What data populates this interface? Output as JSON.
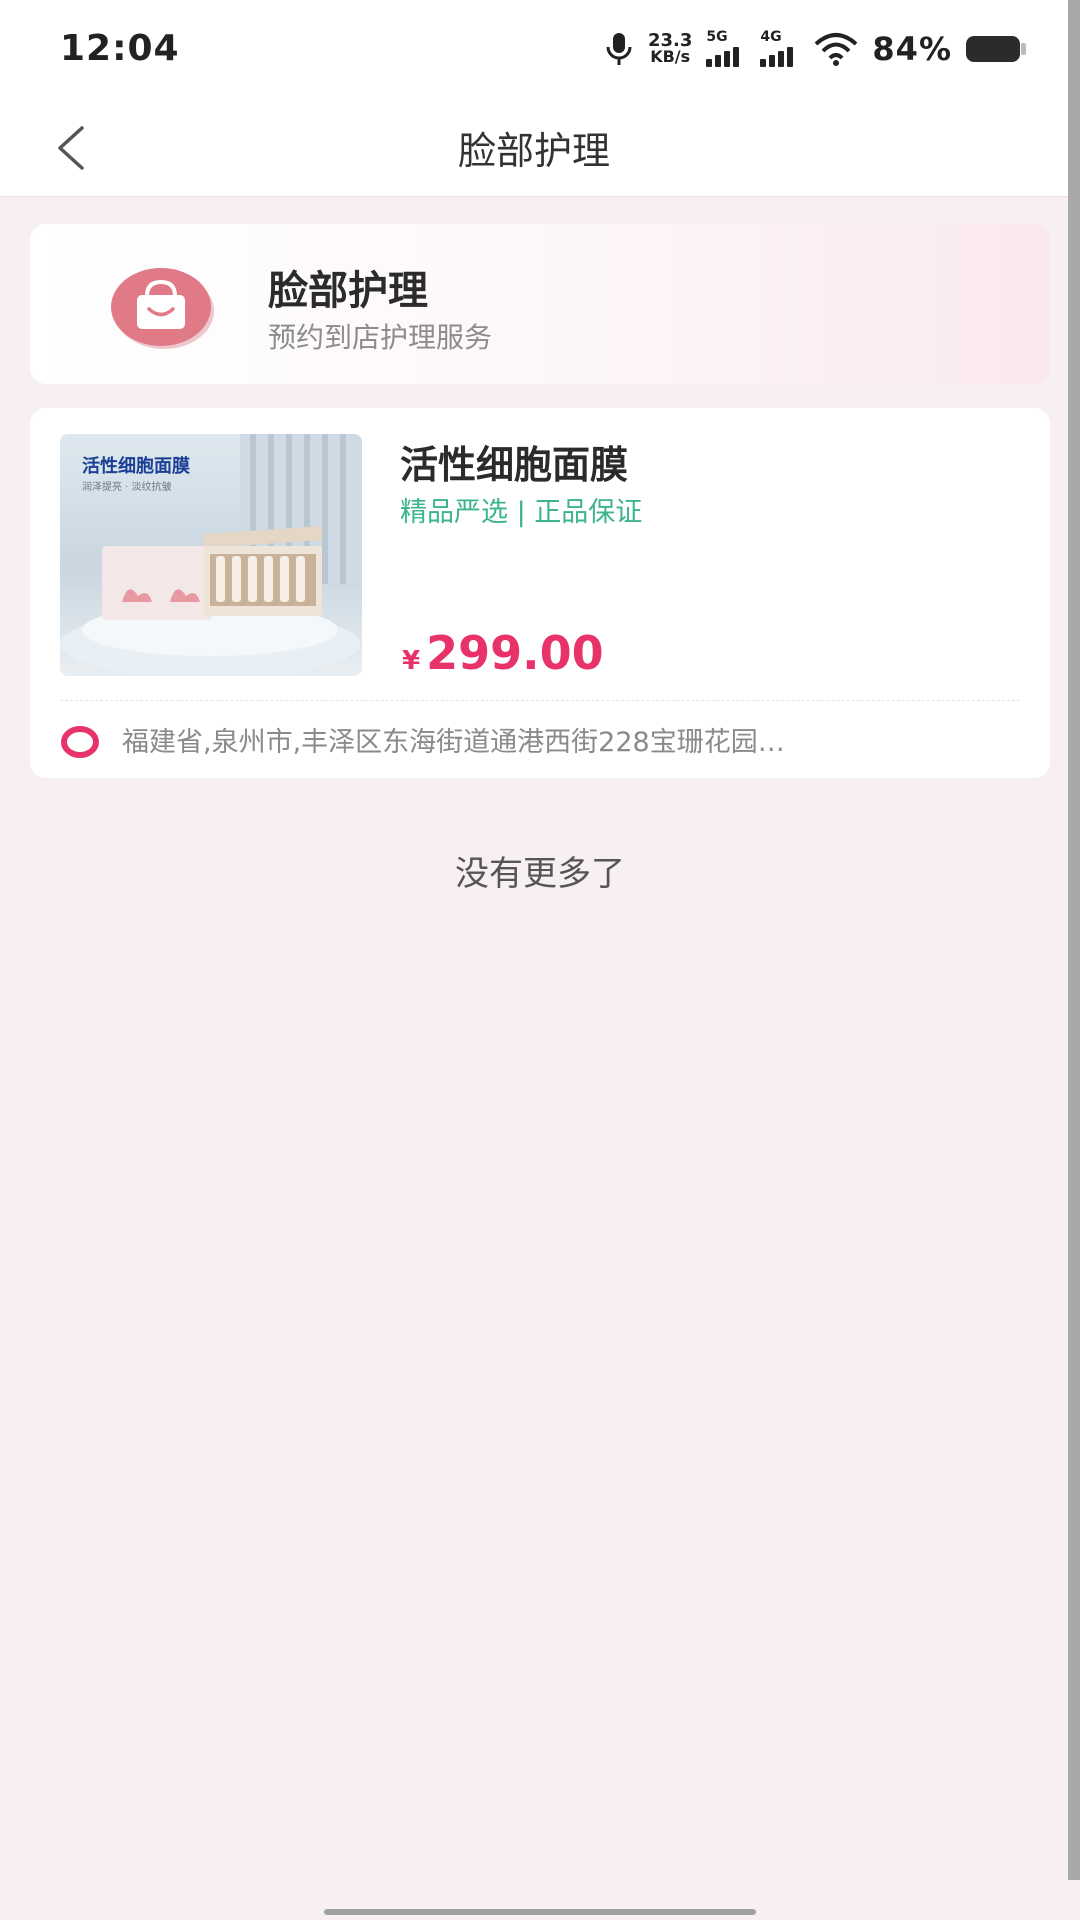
{
  "status": {
    "time": "12:04",
    "speed_value": "23.3",
    "speed_unit": "KB/s",
    "net1": "5G",
    "net2": "4G",
    "battery": "84%"
  },
  "nav": {
    "title": "脸部护理",
    "back_icon": "chevron-left-icon"
  },
  "category": {
    "title": "脸部护理",
    "subtitle": "预约到店护理服务",
    "icon": "shopping-bag-icon",
    "icon_color": "#e07a86"
  },
  "product": {
    "image_title": "活性细胞面膜",
    "image_sub": "润泽提亮 · 淡纹抗皱",
    "name": "活性细胞面膜",
    "tag": "精品严选 | 正品保证",
    "price_symbol": "¥",
    "price": "299.00",
    "address": "福建省,泉州市,丰泽区东海街道通港西街228宝珊花园…",
    "location_icon": "location-ring-icon",
    "accent": "#e8336a",
    "tag_color": "#3cb58a"
  },
  "footer": {
    "no_more": "没有更多了"
  }
}
